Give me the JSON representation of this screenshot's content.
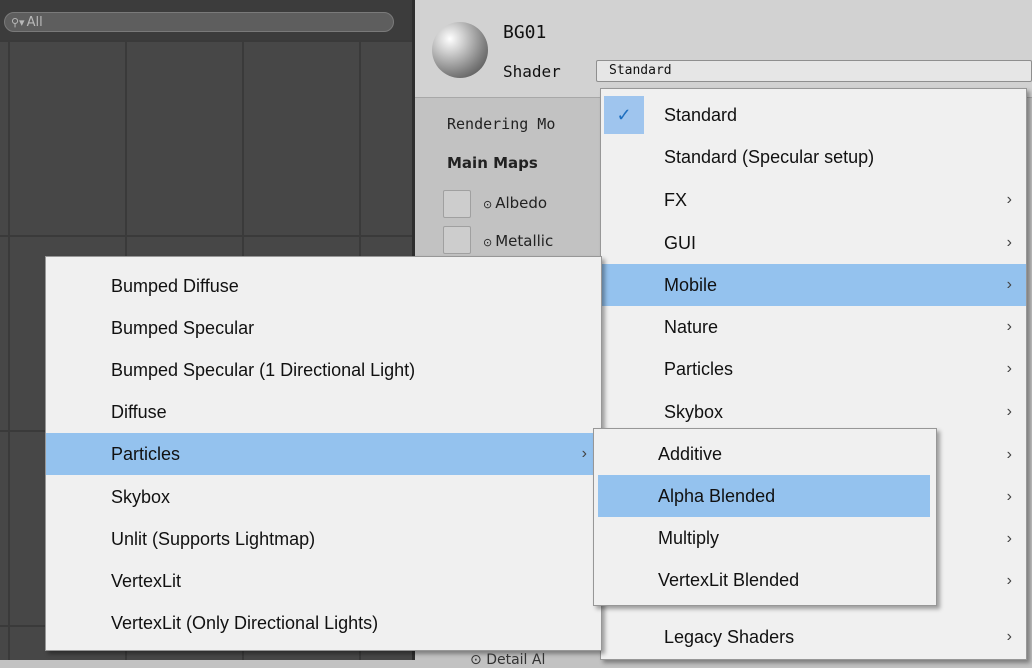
{
  "scene": {
    "search_text": "All",
    "search_icon": "search-icon"
  },
  "inspector": {
    "material_name": "BG01",
    "shader_label": "Shader",
    "shader_value": "Standard",
    "rendering_mode_label": "Rendering Mo",
    "main_maps_label": "Main Maps",
    "albedo_label": "Albedo",
    "metallic_label": "Metallic",
    "detail_label": "Detail Al"
  },
  "main_menu": {
    "items": [
      {
        "label": "Standard",
        "checked": true,
        "submenu": false
      },
      {
        "label": "Standard (Specular setup)",
        "submenu": false
      },
      {
        "label": "FX",
        "submenu": true
      },
      {
        "label": "GUI",
        "submenu": true
      },
      {
        "label": "Mobile",
        "submenu": true,
        "highlighted": true
      },
      {
        "label": "Nature",
        "submenu": true
      },
      {
        "label": "Particles",
        "submenu": true
      },
      {
        "label": "Skybox",
        "submenu": true
      },
      {
        "label": "",
        "submenu": true
      },
      {
        "label": "",
        "submenu": true
      },
      {
        "label": "",
        "submenu": true
      },
      {
        "label": "",
        "submenu": true
      },
      {
        "label": "Legacy Shaders",
        "submenu": true
      }
    ]
  },
  "mobile_menu": {
    "items": [
      {
        "label": "Bumped Diffuse"
      },
      {
        "label": "Bumped Specular"
      },
      {
        "label": "Bumped Specular (1 Directional Light)"
      },
      {
        "label": "Diffuse"
      },
      {
        "label": "Particles",
        "submenu": true,
        "highlighted": true
      },
      {
        "label": "Skybox"
      },
      {
        "label": "Unlit (Supports Lightmap)"
      },
      {
        "label": "VertexLit"
      },
      {
        "label": "VertexLit (Only Directional Lights)"
      }
    ]
  },
  "particles_menu": {
    "items": [
      {
        "label": "Additive"
      },
      {
        "label": "Alpha Blended",
        "highlighted": true
      },
      {
        "label": "Multiply"
      },
      {
        "label": "VertexLit Blended"
      }
    ]
  },
  "colors": {
    "highlight": "#94c2ee",
    "menu_bg": "#f0f0f0",
    "scene_bg": "#474747"
  }
}
